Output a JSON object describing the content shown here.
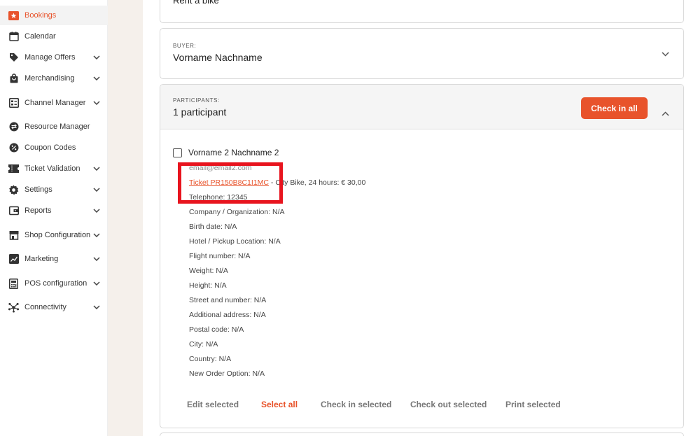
{
  "sidebar": {
    "items": [
      {
        "label": "Bookings",
        "icon": "ticket-star-icon"
      },
      {
        "label": "Calendar",
        "icon": "calendar-icon"
      },
      {
        "label": "Manage Offers",
        "icon": "tag-icon"
      },
      {
        "label": "Merchandising",
        "icon": "shopping-bag-icon"
      },
      {
        "label": "Channel Manager",
        "icon": "list-icon"
      },
      {
        "label": "Resource Manager",
        "icon": "swap-icon"
      },
      {
        "label": "Coupon Codes",
        "icon": "percent-icon"
      },
      {
        "label": "Ticket Validation",
        "icon": "ticket-icon"
      },
      {
        "label": "Settings",
        "icon": "gear-icon"
      },
      {
        "label": "Reports",
        "icon": "wallet-icon"
      },
      {
        "label": "Shop Configuration",
        "icon": "store-icon"
      },
      {
        "label": "Marketing",
        "icon": "chart-icon"
      },
      {
        "label": "POS configuration",
        "icon": "calculator-icon"
      },
      {
        "label": "Connectivity",
        "icon": "network-icon"
      }
    ]
  },
  "offer": {
    "value": "Rent a bike"
  },
  "buyer": {
    "label": "BUYER:",
    "value": "Vorname Nachname"
  },
  "participants": {
    "label": "PARTICIPANTS:",
    "value": "1 participant",
    "check_in_all": "Check in all",
    "participant": {
      "name": "Vorname 2 Nachname 2",
      "email": "email@email2.com",
      "ticket_link": "Ticket PR150B8C1I1MC",
      "ticket_rest": " - City Bike, 24 hours: € 30,00",
      "details": [
        "Telephone: 12345",
        "Company / Organization: N/A",
        "Birth date: N/A",
        "Hotel / Pickup Location: N/A",
        "Flight number: N/A",
        "Weight: N/A",
        "Height: N/A",
        "Street and number: N/A",
        "Additional address: N/A",
        "Postal code: N/A",
        "City: N/A",
        "Country: N/A",
        "New Order Option: N/A"
      ]
    },
    "actions": {
      "edit_selected": "Edit selected",
      "select_all": "Select all",
      "check_in_selected": "Check in selected",
      "check_out_selected": "Check out selected",
      "print_selected": "Print selected"
    }
  },
  "colors": {
    "accent": "#e8532b",
    "highlight": "#e8141e"
  }
}
